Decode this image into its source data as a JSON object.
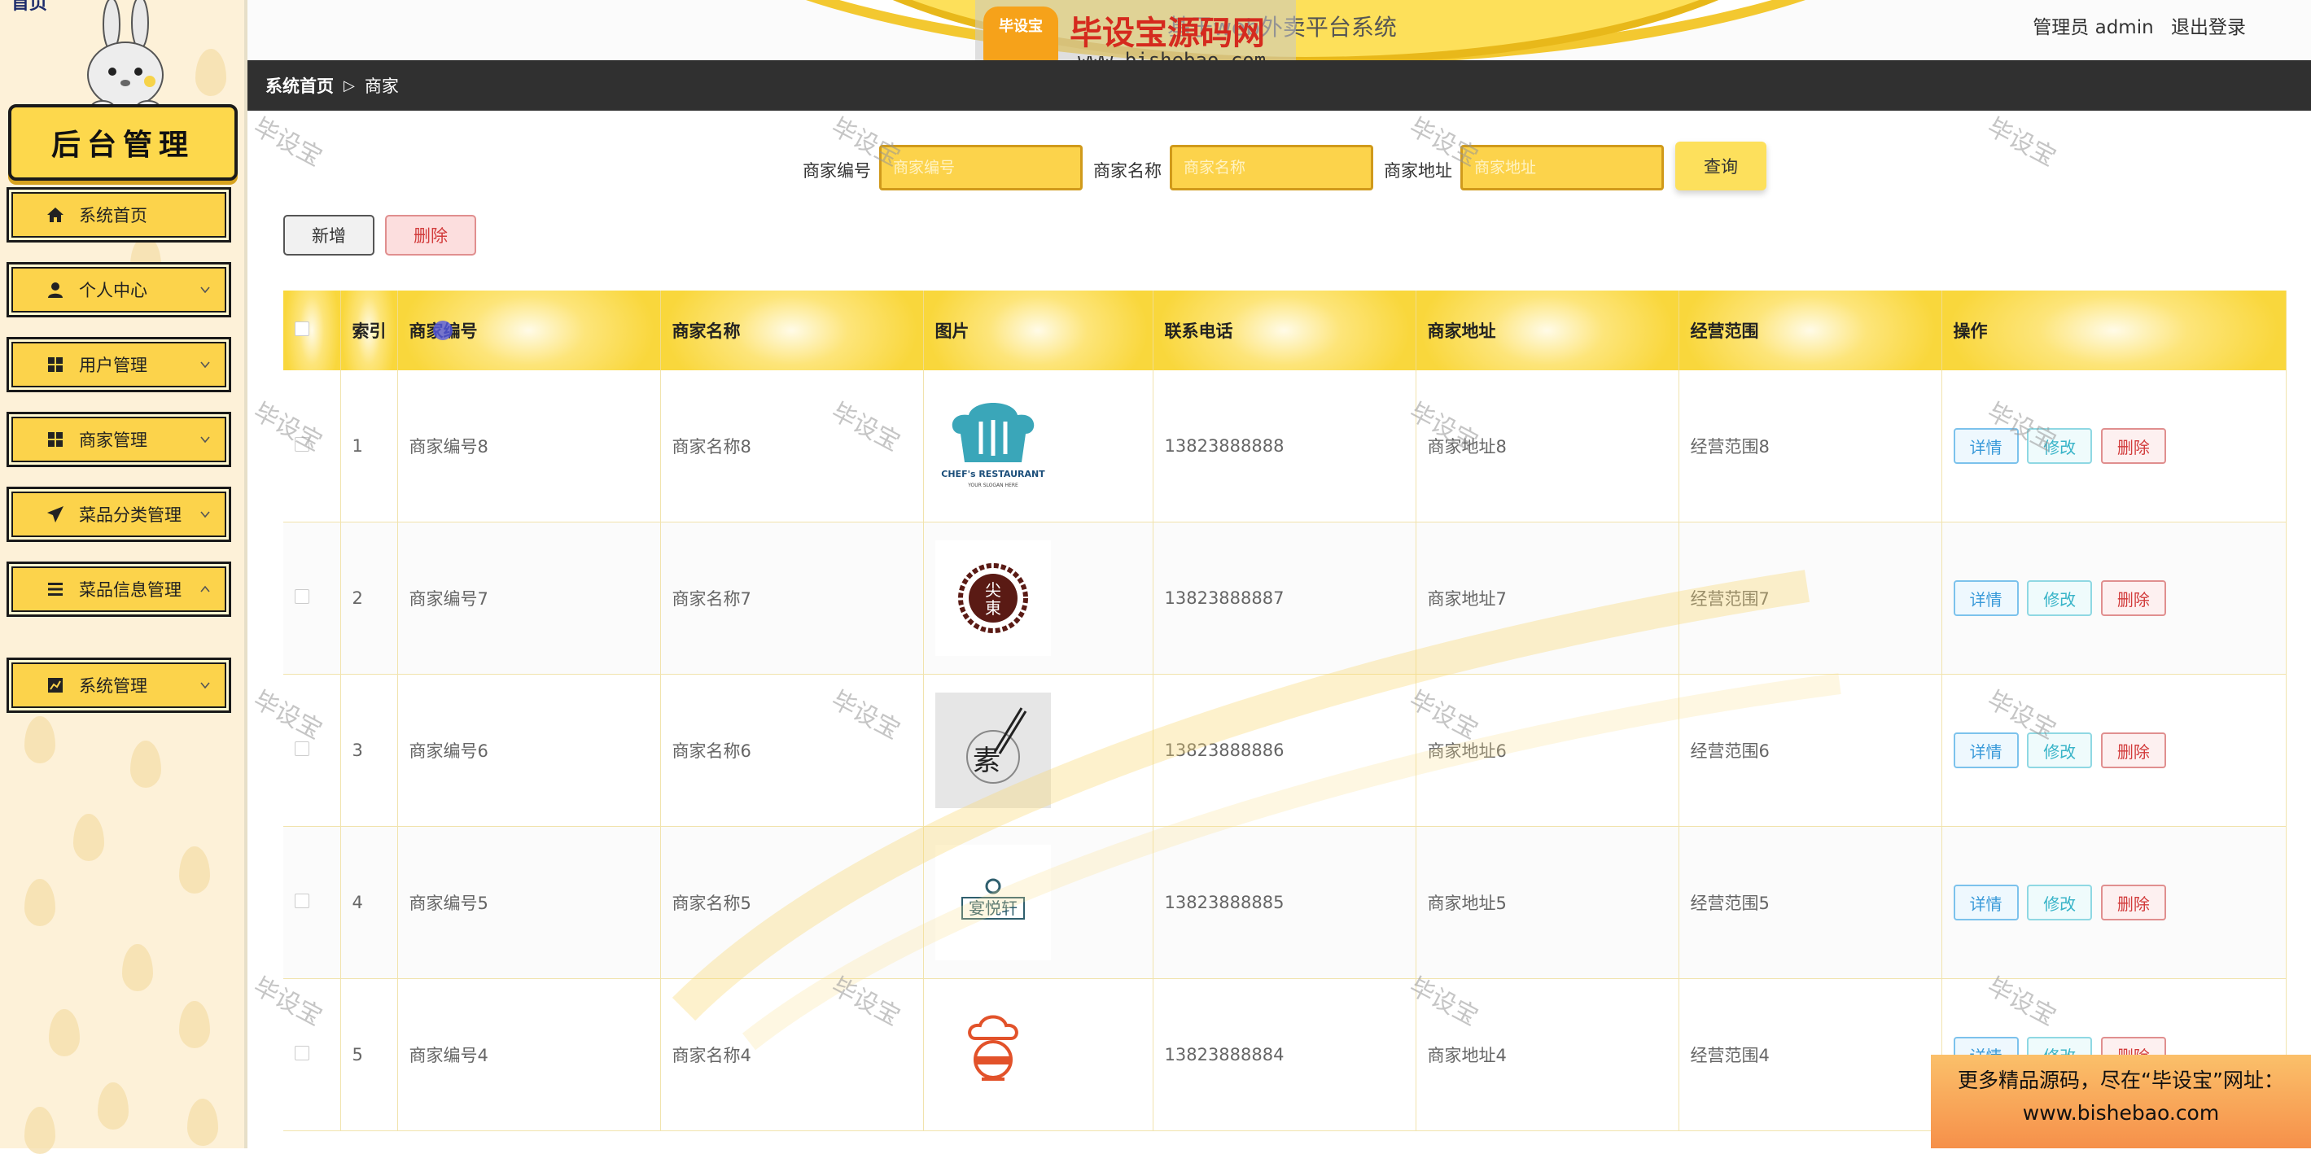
{
  "sidebar": {
    "corner_text": "首页",
    "logo_text": "后台管理",
    "items": [
      {
        "label": "系统首页",
        "icon": "home-icon"
      },
      {
        "label": "个人中心",
        "icon": "user-icon"
      },
      {
        "label": "用户管理",
        "icon": "grid-icon"
      },
      {
        "label": "商家管理",
        "icon": "grid-icon"
      },
      {
        "label": "菜品分类管理",
        "icon": "paper-plane-icon"
      },
      {
        "label": "菜品信息管理",
        "icon": "list-icon"
      },
      {
        "label": "系统管理",
        "icon": "chart-icon"
      }
    ]
  },
  "header": {
    "site_title": "基于web外卖平台系统",
    "user_label": "管理员 admin",
    "logout_label": "退出登录"
  },
  "watermark": {
    "badge": "毕设宝",
    "main": "毕设宝源码网",
    "url": "www.bishebao.com",
    "stamp": "毕设宝"
  },
  "breadcrumb": {
    "home": "系统首页",
    "separator": "▷",
    "current": "商家"
  },
  "search": {
    "fields": [
      {
        "label": "商家编号",
        "placeholder": "商家编号"
      },
      {
        "label": "商家名称",
        "placeholder": "商家名称"
      },
      {
        "label": "商家地址",
        "placeholder": "商家地址"
      }
    ],
    "button": "查询"
  },
  "actions": {
    "add": "新增",
    "delete": "删除"
  },
  "table": {
    "columns": [
      "索引",
      "商家编号",
      "商家名称",
      "图片",
      "联系电话",
      "商家地址",
      "经营范围",
      "操作"
    ],
    "rows": [
      {
        "index": "1",
        "code": "商家编号8",
        "name": "商家名称8",
        "image": "Chef's Restaurant logo",
        "phone": "13823888888",
        "address": "商家地址8",
        "scope": "经营范围8"
      },
      {
        "index": "2",
        "code": "商家编号7",
        "name": "商家名称7",
        "image": "尖東 round seal logo",
        "phone": "13823888887",
        "address": "商家地址7",
        "scope": "经营范围7"
      },
      {
        "index": "3",
        "code": "商家编号6",
        "name": "商家名称6",
        "image": "素 chopsticks logo",
        "phone": "13823888886",
        "address": "商家地址6",
        "scope": "经营范围6"
      },
      {
        "index": "4",
        "code": "商家编号5",
        "name": "商家名称5",
        "image": "宴悦轩 logo",
        "phone": "13823888885",
        "address": "商家地址5",
        "scope": "经营范围5"
      },
      {
        "index": "5",
        "code": "商家编号4",
        "name": "商家名称4",
        "image": "chef mascot logo",
        "phone": "13823888884",
        "address": "商家地址4",
        "scope": "经营范围4"
      }
    ],
    "op_detail": "详情",
    "op_edit": "修改",
    "op_delete": "删除"
  },
  "promo": {
    "line1": "更多精品源码，尽在“毕设宝”网址：",
    "line2": "www.bishebao.com"
  },
  "colors": {
    "accent": "#fcd34b",
    "dark_bar": "#303030",
    "sidebar_bg": "#fdf1d8",
    "danger": "#d23b3b",
    "info": "#3a9ad9"
  }
}
